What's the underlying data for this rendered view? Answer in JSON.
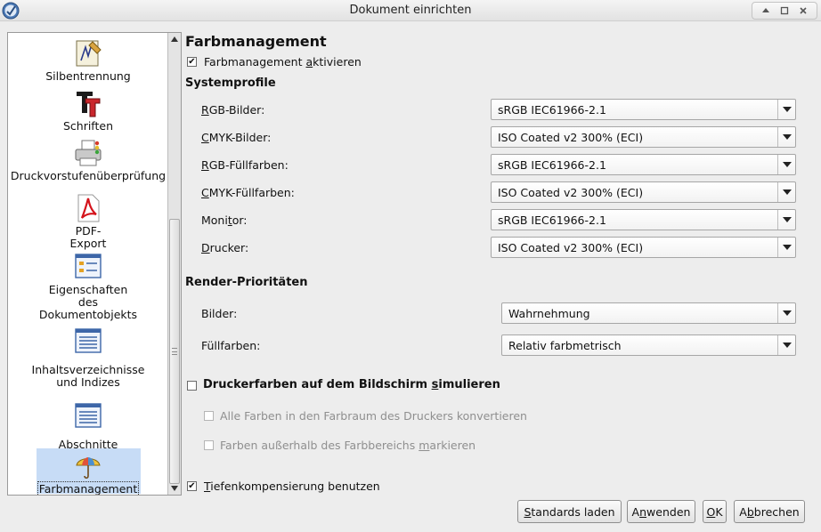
{
  "window": {
    "title": "Dokument einrichten"
  },
  "sidebar": {
    "items": [
      {
        "label": "Silbentrennung",
        "icon": "hyphenation-icon"
      },
      {
        "label": "Schriften",
        "icon": "fonts-icon"
      },
      {
        "label": "Druckvorstufenüberprüfung",
        "icon": "preflight-printer-icon"
      },
      {
        "label_lines": [
          "PDF-",
          "Export"
        ],
        "icon": "pdf-icon"
      },
      {
        "label_lines": [
          "Eigenschaften",
          "des",
          "Dokumentobjekts"
        ],
        "icon": "document-properties-icon"
      },
      {
        "label_lines": [
          "Inhaltsverzeichnisse",
          "und Indizes"
        ],
        "icon": "table-of-contents-icon"
      },
      {
        "label": "Abschnitte",
        "icon": "sections-icon"
      },
      {
        "label": "Farbmanagement",
        "icon": "color-management-umbrella-icon",
        "selected": true
      }
    ]
  },
  "main": {
    "heading": "Farbmanagement",
    "enable": {
      "label_pre": "Farbmanagement ",
      "label_u": "a",
      "label_post": "ktivieren",
      "checked": true
    },
    "system_profiles": {
      "title": "Systemprofile",
      "rows": [
        {
          "u": "R",
          "rest": "GB-Bilder:",
          "value": "sRGB IEC61966-2.1"
        },
        {
          "u": "C",
          "rest": "MYK-Bilder:",
          "value": "ISO Coated v2 300% (ECI)"
        },
        {
          "u": "R",
          "rest": "GB-Füllfarben:",
          "value": "sRGB IEC61966-2.1"
        },
        {
          "u": "C",
          "rest": "MYK-Füllfarben:",
          "value": "ISO Coated v2 300% (ECI)"
        },
        {
          "pre": "Moni",
          "u": "t",
          "rest": "or:",
          "value": "sRGB IEC61966-2.1"
        },
        {
          "u": "D",
          "rest": "rucker:",
          "value": "ISO Coated v2 300% (ECI)"
        }
      ]
    },
    "render_priorities": {
      "title": "Render-Prioritäten",
      "rows": [
        {
          "label": "Bilder:",
          "value": "Wahrnehmung"
        },
        {
          "label": "Füllfarben:",
          "value": "Relativ farbmetrisch"
        }
      ]
    },
    "simulate": {
      "label_pre": "Druckerfarben auf dem Bildschirm ",
      "label_u": "s",
      "label_post": "imulieren",
      "checked": false
    },
    "convert_all": {
      "label": "Alle Farben in den Farbraum des Druckers konvertieren",
      "checked": false
    },
    "mark_out_of_gamut": {
      "label_pre": "Farben außerhalb des Farbbereichs ",
      "label_u": "m",
      "label_post": "arkieren",
      "checked": false
    },
    "black_point": {
      "label_u": "T",
      "label_post": "iefenkompensierung benutzen",
      "checked": true
    }
  },
  "buttons": {
    "defaults": {
      "u": "S",
      "rest": "tandards laden"
    },
    "apply": {
      "pre": "A",
      "u": "n",
      "rest": "wenden"
    },
    "ok": {
      "u": "O",
      "rest": "K"
    },
    "cancel": {
      "pre": "A",
      "u": "b",
      "rest": "brechen"
    }
  },
  "check_mark": "✔"
}
